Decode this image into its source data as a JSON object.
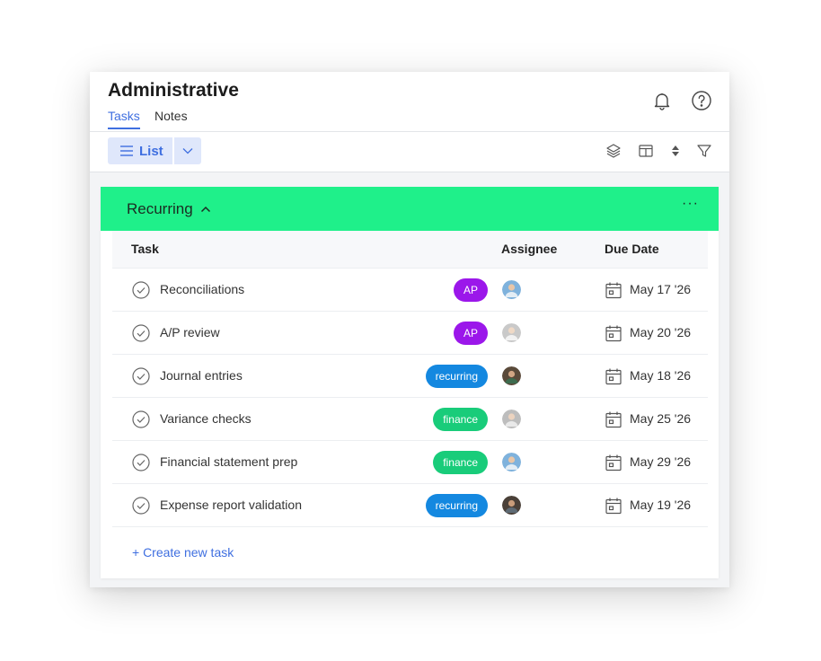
{
  "header": {
    "title": "Administrative",
    "tabs": [
      {
        "label": "Tasks",
        "active": true
      },
      {
        "label": "Notes",
        "active": false
      }
    ],
    "icons": [
      "bell-icon",
      "help-icon"
    ]
  },
  "toolbar": {
    "view_label": "List",
    "icons": [
      "layers-icon",
      "columns-icon",
      "sort-icon",
      "filter-icon"
    ]
  },
  "group": {
    "title": "Recurring",
    "color": "#1ff08a",
    "more": "···"
  },
  "table": {
    "columns": [
      "Task",
      "Assignee",
      "Due Date"
    ],
    "rows": [
      {
        "task": "Reconciliations",
        "tag": "AP",
        "due": "May 17 '26"
      },
      {
        "task": "A/P review",
        "tag": "AP",
        "due": "May 20 '26"
      },
      {
        "task": "Journal entries",
        "tag": "recurring",
        "due": "May 18 '26"
      },
      {
        "task": "Variance checks",
        "tag": "finance",
        "due": "May 25 '26"
      },
      {
        "task": "Financial statement prep",
        "tag": "finance",
        "due": "May 29 '26"
      },
      {
        "task": "Expense report validation",
        "tag": "recurring",
        "due": "May 19 '26"
      }
    ]
  },
  "tag_colors": {
    "AP": "#9b17ea",
    "recurring": "#1488e0",
    "finance": "#19cc7a"
  },
  "create_task_label": "+ Create new task"
}
